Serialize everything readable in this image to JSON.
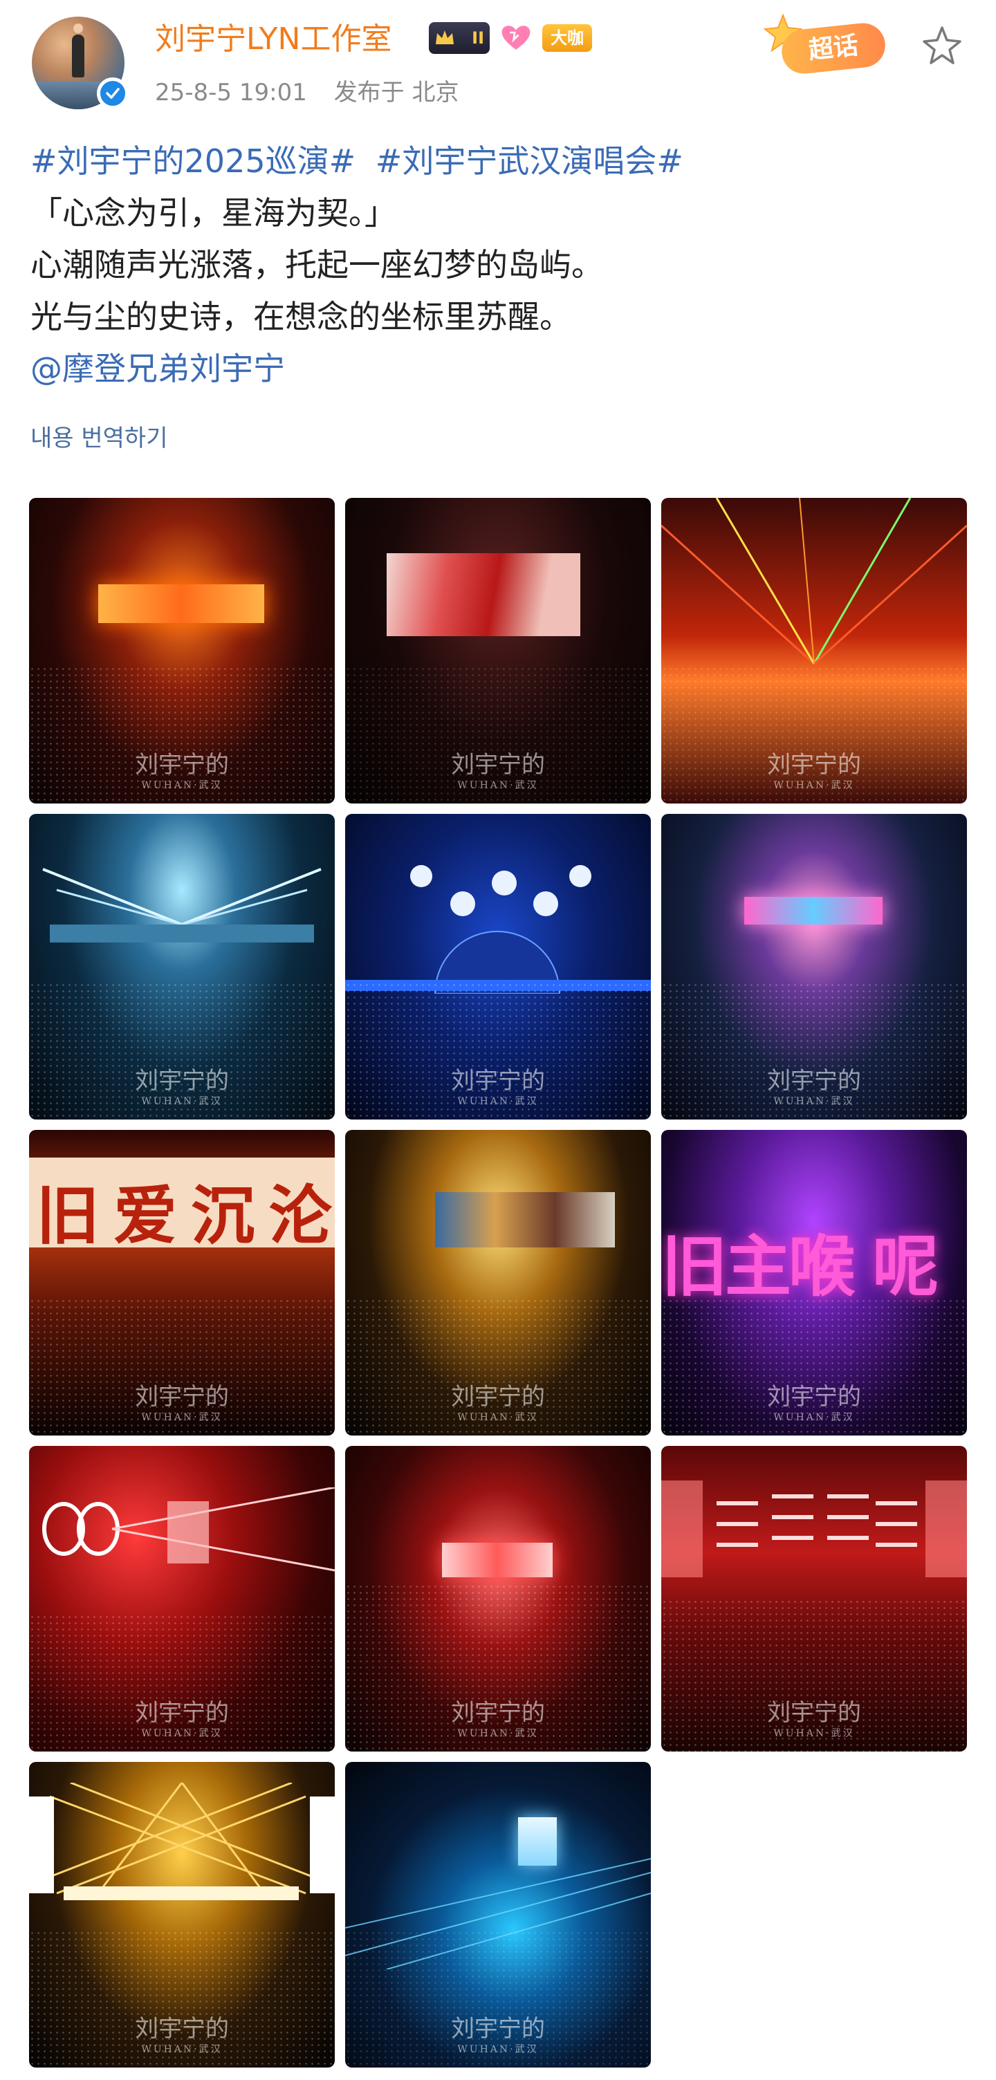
{
  "post": {
    "author": "刘宇宁LYN工作室",
    "level_badge": "II",
    "big_badge": "大咖",
    "date": "25-8-5 19:01",
    "published_in": "发布于 北京",
    "super_topic": "超话",
    "lines": [
      {
        "hashtags": [
          "#刘宇宁的2025巡演#",
          "#刘宇宁武汉演唱会#"
        ]
      },
      {
        "text": "「心念为引，星海为契。」"
      },
      {
        "text": "心潮随声光涨落，托起一座幻梦的岛屿。"
      },
      {
        "text": "光与尘的史诗，在想念的坐标里苏醒。"
      },
      {
        "mention": "@摩登兄弟刘宇宁"
      }
    ],
    "translate_link": "내용 번역하기"
  },
  "images": {
    "watermark_name": "刘宇宁的",
    "watermark_place": "WUHAN·武汉",
    "screen_texts": {
      "t7": "旧 爱 沉 沦",
      "t9": "旧主喉 呢"
    },
    "count": 14
  },
  "colors": {
    "author_orange": "#f17c1c",
    "link_blue": "#3a6bb5",
    "meta_gray": "#8a8a8a"
  }
}
